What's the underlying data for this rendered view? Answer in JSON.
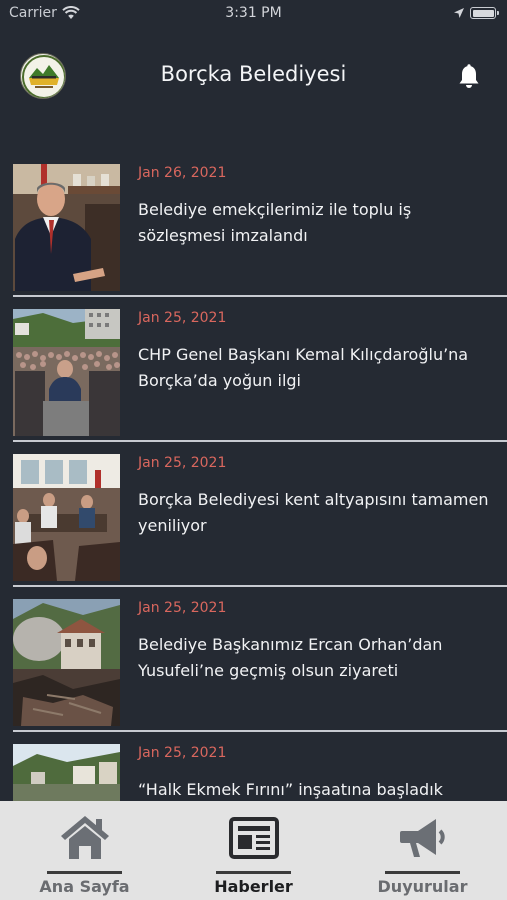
{
  "status_bar": {
    "carrier": "Carrier",
    "time": "3:31 PM"
  },
  "header": {
    "title": "Borçka Belediyesi",
    "logo_icon": "municipality-logo-icon",
    "bell_icon": "bell-icon"
  },
  "news": [
    {
      "date": "Jan 26, 2021",
      "title": "Belediye emekçilerimiz ile toplu iş sözleşmesi imzalandı"
    },
    {
      "date": "Jan 25, 2021",
      "title": "CHP Genel Başkanı Kemal Kılıçdaroğlu’na Borçka’da yoğun ilgi"
    },
    {
      "date": "Jan 25, 2021",
      "title": "Borçka Belediyesi kent altyapısını tamamen yeniliyor"
    },
    {
      "date": "Jan 25, 2021",
      "title": "Belediye Başkanımız Ercan Orhan’dan Yusufeli’ne geçmiş olsun ziyareti"
    },
    {
      "date": "Jan 25, 2021",
      "title": "“Halk Ekmek Fırını” inşaatına başladık"
    }
  ],
  "tabs": [
    {
      "label": "Ana Sayfa",
      "icon": "home-icon",
      "active": false
    },
    {
      "label": "Haberler",
      "icon": "newspaper-icon",
      "active": true
    },
    {
      "label": "Duyurular",
      "icon": "megaphone-icon",
      "active": false
    }
  ],
  "colors": {
    "background": "#252a33",
    "date": "#d9675e",
    "tab_bar": "#e3e3e3"
  }
}
